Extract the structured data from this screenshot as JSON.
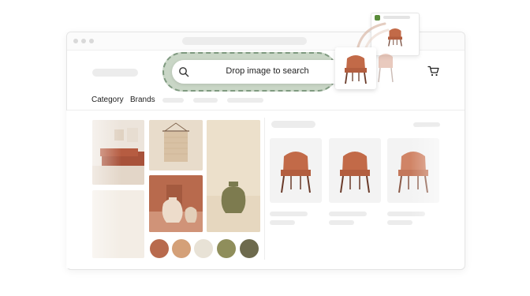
{
  "header": {
    "search": {
      "label": "Drop image to search",
      "icon": "search-icon"
    },
    "nav": [
      {
        "label": "Category"
      },
      {
        "label": "Brands"
      }
    ],
    "cart_icon": "cart-icon"
  },
  "moodboard": {
    "swatches": [
      "#b86a4d",
      "#d4a078",
      "#e8e2d6",
      "#8f8e5b",
      "#6d6a4d"
    ]
  },
  "products": {
    "chair_color": "#c26a48",
    "count": 3
  },
  "colors": {
    "dropzone_fill": "#c9d6c6",
    "dropzone_border": "#7f9a80",
    "store_badge": "#5a8c3a"
  }
}
